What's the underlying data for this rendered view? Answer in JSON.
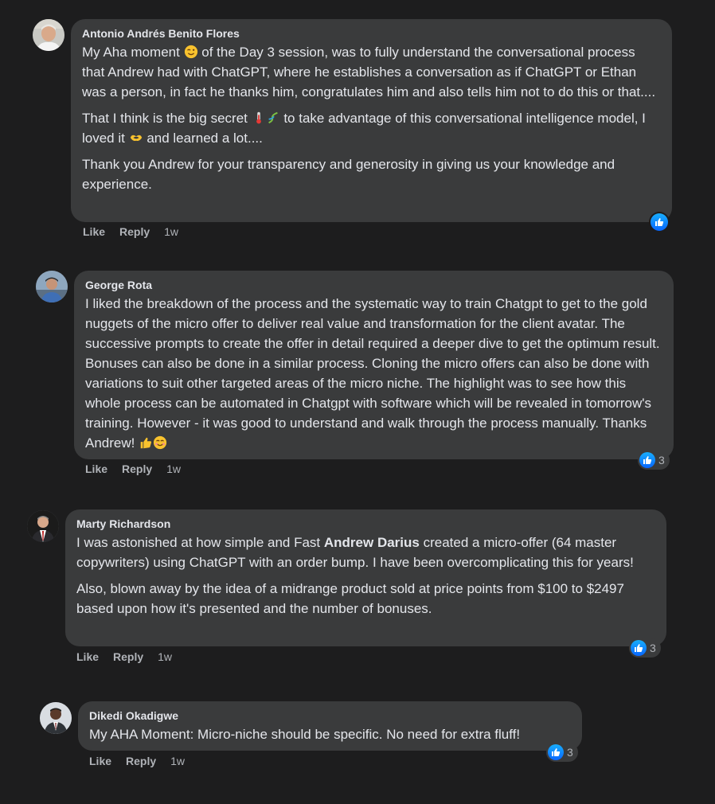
{
  "comments": [
    {
      "author": "Antonio Andrés Benito Flores",
      "paragraphs": [
        {
          "parts": [
            "My Aha moment ",
            " of the Day 3 session, was to fully understand the conversational process that Andrew had with ChatGPT, where he establishes a conversation as if ChatGPT or Ethan was a person, in fact he thanks him, congratulates him and also tells him not to do this or that...."
          ]
        },
        {
          "parts": [
            "That I think is the big secret ",
            " to take advantage of this conversational intelligence model, I loved it ",
            " and learned a lot...."
          ]
        },
        {
          "parts": [
            "Thank you Andrew for your transparency and generosity in giving us your knowledge and experience."
          ]
        }
      ],
      "actions": {
        "like": "Like",
        "reply": "Reply",
        "time": "1w"
      },
      "reaction_count": ""
    },
    {
      "author": "George Rota",
      "paragraphs": [
        {
          "parts": [
            "I liked the breakdown of the process and the systematic way to train Chatgpt to get to the gold nuggets of the micro offer to deliver real value and transformation for the client avatar. The successive prompts to create the offer in detail required a deeper dive to get the optimum result. Bonuses can also be done in a similar process. Cloning the micro offers can also be done with variations to suit other targeted areas of the micro niche. The highlight was to see how this whole process can be automated in Chatgpt with software which will be revealed in tomorrow's training. However - it was good to understand and walk through the process manually. Thanks Andrew! "
          ]
        }
      ],
      "actions": {
        "like": "Like",
        "reply": "Reply",
        "time": "1w"
      },
      "reaction_count": "3"
    },
    {
      "author": "Marty Richardson",
      "paragraphs": [
        {
          "parts": [
            "I was astonished at how simple and Fast ",
            "Andrew Darius",
            " created a micro-offer (64 master copywriters) using ChatGPT with an order bump. I have been overcomplicating this for years!"
          ]
        },
        {
          "parts": [
            "Also, blown away by the idea of a midrange product sold at price points from $100 to $2497 based upon how it's presented and the number of bonuses."
          ]
        }
      ],
      "actions": {
        "like": "Like",
        "reply": "Reply",
        "time": "1w"
      },
      "reaction_count": "3"
    },
    {
      "author": "Dikedi Okadigwe",
      "paragraphs": [
        {
          "parts": [
            "My AHA Moment: Micro-niche should be specific. No need for extra fluff!"
          ]
        }
      ],
      "actions": {
        "like": "Like",
        "reply": "Reply",
        "time": "1w"
      },
      "reaction_count": "3"
    }
  ],
  "icons": {
    "reaction": "like-thumb-icon",
    "emoji_wink": "winking-face-icon",
    "emoji_thermometer": "thermometer-icon",
    "emoji_dna": "dna-icon",
    "emoji_heart_hands": "heart-hands-icon",
    "emoji_thumbs_up": "thumbs-up-icon",
    "emoji_smile": "smiling-face-icon"
  },
  "colors": {
    "background": "#1d1d1e",
    "bubble": "#3a3b3c",
    "text": "#e4e6eb",
    "muted": "#b0b3b8",
    "like_blue": "#0866ff"
  }
}
